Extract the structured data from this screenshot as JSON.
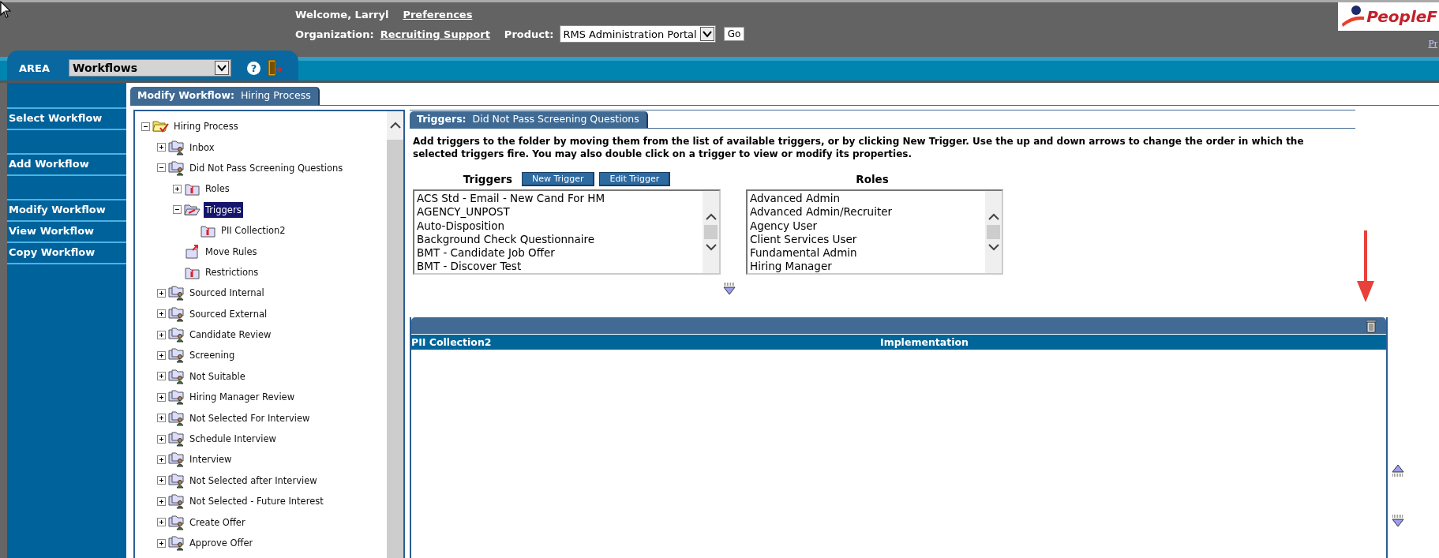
{
  "header": {
    "welcome": "Welcome, Larryl",
    "preferences_link": "Preferences",
    "organization_label": "Organization:",
    "organization_link": "Recruiting Support",
    "product_label": "Product:",
    "product_select": "RMS Administration Portal",
    "go_button": "Go",
    "logo_text": "PeopleF",
    "corner_link": "Pr"
  },
  "area_bar": {
    "label": "AREA",
    "select": "Workflows",
    "help_glyph": "?"
  },
  "sidebar": {
    "groups": [
      [
        {
          "label": "Select Workflow"
        }
      ],
      [
        {
          "label": "Add Workflow"
        }
      ],
      [
        {
          "label": "Modify Workflow"
        },
        {
          "label": "View Workflow"
        },
        {
          "label": "Copy Workflow"
        }
      ]
    ]
  },
  "modify_tab": {
    "label": "Modify Workflow:",
    "value": "Hiring Process"
  },
  "tree": {
    "label": "Hiring Process",
    "kind": "root",
    "expanded": true,
    "selected": false,
    "children": [
      {
        "label": "Inbox",
        "kind": "workflow",
        "expanded": false,
        "selected": false
      },
      {
        "label": "Did Not Pass Screening Questions",
        "kind": "workflow",
        "expanded": true,
        "selected": false,
        "children": [
          {
            "label": "Roles",
            "kind": "info",
            "expanded": false,
            "selected": false
          },
          {
            "label": "Triggers",
            "kind": "open",
            "expanded": true,
            "selected": true,
            "children": [
              {
                "label": "PII Collection2",
                "kind": "info",
                "selected": false
              }
            ]
          },
          {
            "label": "Move Rules",
            "kind": "move",
            "selected": false
          },
          {
            "label": "Restrictions",
            "kind": "info",
            "selected": false
          }
        ]
      },
      {
        "label": "Sourced Internal",
        "kind": "workflow",
        "expanded": false,
        "selected": false
      },
      {
        "label": "Sourced External",
        "kind": "workflow",
        "expanded": false,
        "selected": false
      },
      {
        "label": "Candidate Review",
        "kind": "workflow",
        "expanded": false,
        "selected": false
      },
      {
        "label": "Screening",
        "kind": "workflow",
        "expanded": false,
        "selected": false
      },
      {
        "label": "Not Suitable",
        "kind": "workflow",
        "expanded": false,
        "selected": false
      },
      {
        "label": "Hiring Manager Review",
        "kind": "workflow",
        "expanded": false,
        "selected": false
      },
      {
        "label": "Not Selected For Interview",
        "kind": "workflow",
        "expanded": false,
        "selected": false
      },
      {
        "label": "Schedule Interview",
        "kind": "workflow",
        "expanded": false,
        "selected": false
      },
      {
        "label": "Interview",
        "kind": "workflow",
        "expanded": false,
        "selected": false
      },
      {
        "label": "Not Selected after Interview",
        "kind": "workflow",
        "expanded": false,
        "selected": false
      },
      {
        "label": "Not Selected - Future Interest",
        "kind": "workflow",
        "expanded": false,
        "selected": false
      },
      {
        "label": "Create Offer",
        "kind": "workflow",
        "expanded": false,
        "selected": false
      },
      {
        "label": "Approve Offer",
        "kind": "workflow",
        "expanded": false,
        "selected": false
      }
    ]
  },
  "triggers_tab": {
    "label": "Triggers:",
    "value": "Did Not Pass Screening Questions"
  },
  "description": "Add triggers to the folder by moving them from the list of available triggers, or by clicking New Trigger. Use the up and down arrows to change the order in which the selected triggers fire. You may also double click on a trigger to view or modify its properties.",
  "triggers": {
    "title": "Triggers",
    "buttons": [
      "New Trigger",
      "Edit Trigger"
    ],
    "items": [
      "ACS Std - Email - New Cand For HM",
      "AGENCY_UNPOST",
      "Auto-Disposition",
      "Background Check Questionnaire",
      "BMT - Candidate Job Offer",
      "BMT - Discover Test"
    ]
  },
  "roles": {
    "title": "Roles",
    "items": [
      "Advanced Admin",
      "Advanced Admin/Recruiter",
      "Agency User",
      "Client Services User",
      "Fundamental Admin",
      "Hiring Manager"
    ]
  },
  "selected_table": {
    "columns": [
      "PII Collection2",
      "Implementation"
    ]
  }
}
